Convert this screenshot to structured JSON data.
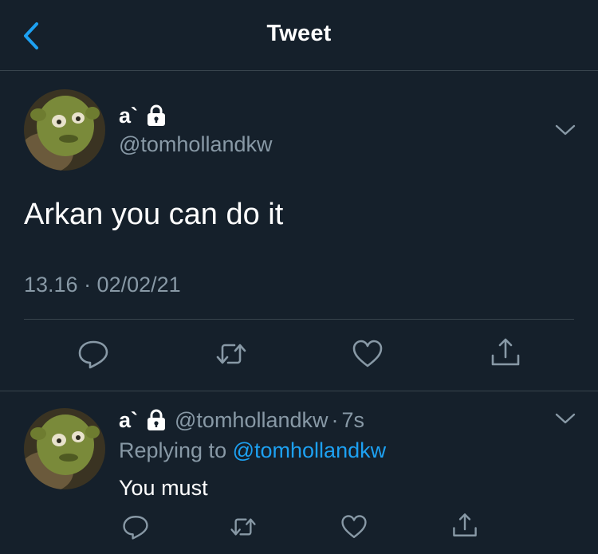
{
  "header": {
    "title": "Tweet",
    "back_icon": "chevron-left-icon"
  },
  "tweet": {
    "display_name": "a`",
    "handle": "@tomhollandkw",
    "text": "Arkan you can do it",
    "timestamp": "13.16 · 02/02/21",
    "icons": {
      "locked": "lock-icon",
      "menu": "chevron-down-icon",
      "reply": "reply-icon",
      "retweet": "retweet-icon",
      "like": "heart-icon",
      "share": "share-icon"
    }
  },
  "reply": {
    "display_name": "a`",
    "handle": "@tomhollandkw",
    "separator": "·",
    "time": "7s",
    "replying_prefix": "Replying to",
    "replying_to": "@tomhollandkw",
    "text": "You must"
  },
  "colors": {
    "background": "#15202b",
    "divider": "#38444d",
    "accent": "#1da1f2",
    "secondary_text": "#8899a6"
  }
}
